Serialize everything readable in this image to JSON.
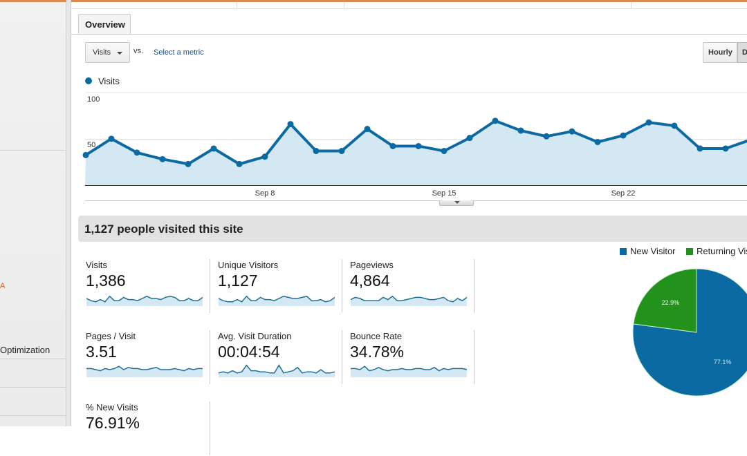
{
  "tabs": [
    {
      "label": "Overview",
      "active": true
    }
  ],
  "controls": {
    "metric_select": "Visits",
    "vs_label": "vs.",
    "select_metric_link": "Select a metric",
    "granularity": [
      "Hourly",
      "D"
    ]
  },
  "colors": {
    "line": "#0b6aa2",
    "area": "#d4e8f4",
    "new_visitor": "#0b6aa2",
    "returning_visitor": "#23921d"
  },
  "sidebar": {
    "partial_red_item": "A",
    "partial_item": "Optimization"
  },
  "chart_data": [
    {
      "type": "area",
      "title": "",
      "legend": [
        "Visits"
      ],
      "xlabel": "",
      "ylabel": "",
      "ylim": [
        0,
        100
      ],
      "yticks": [
        "100",
        "50"
      ],
      "xticks": [
        {
          "label": "Sep 8",
          "index": 7
        },
        {
          "label": "Sep 15",
          "index": 14
        },
        {
          "label": "Sep 22",
          "index": 21
        }
      ],
      "x": [
        "Sep 1",
        "Sep 2",
        "Sep 3",
        "Sep 4",
        "Sep 5",
        "Sep 6",
        "Sep 7",
        "Sep 8",
        "Sep 9",
        "Sep 10",
        "Sep 11",
        "Sep 12",
        "Sep 13",
        "Sep 14",
        "Sep 15",
        "Sep 16",
        "Sep 17",
        "Sep 18",
        "Sep 19",
        "Sep 20",
        "Sep 21",
        "Sep 22",
        "Sep 23",
        "Sep 24",
        "Sep 25",
        "Sep 26",
        "Sep 27"
      ],
      "series": [
        {
          "name": "Visits",
          "values": [
            31,
            51,
            34,
            26,
            20,
            39,
            20,
            29,
            69,
            36,
            36,
            63,
            42,
            42,
            36,
            52,
            73,
            61,
            54,
            60,
            47,
            55,
            71,
            67,
            39,
            39,
            50
          ]
        }
      ]
    },
    {
      "type": "pie",
      "legend": [
        "New Visitor",
        "Returning Visitor"
      ],
      "slices": [
        {
          "name": "New Visitor",
          "value": 77.1,
          "label": "77.1%"
        },
        {
          "name": "Returning Visitor",
          "value": 22.9,
          "label": "22.9%"
        }
      ]
    }
  ],
  "summary": {
    "headline": "1,127 people visited this site"
  },
  "stats": [
    {
      "label": "Visits",
      "value": "1,386",
      "spark": [
        5,
        3,
        2,
        4,
        2,
        7,
        3,
        3,
        6,
        4,
        4,
        3,
        5,
        7,
        5,
        5,
        4,
        6,
        7,
        6,
        3,
        3,
        5,
        3,
        3,
        6
      ]
    },
    {
      "label": "Unique Visitors",
      "value": "1,127",
      "spark": [
        5,
        3,
        2,
        2,
        4,
        2,
        7,
        3,
        3,
        6,
        4,
        4,
        3,
        5,
        7,
        6,
        5,
        5,
        6,
        7,
        3,
        3,
        4,
        2,
        3,
        6
      ]
    },
    {
      "label": "Pageviews",
      "value": "4,864",
      "spark": [
        4,
        6,
        5,
        3,
        3,
        3,
        3,
        6,
        4,
        7,
        3,
        3,
        4,
        5,
        6,
        6,
        5,
        4,
        4,
        5,
        6,
        3,
        2,
        5,
        3,
        6
      ]
    },
    {
      "label": "Pages / Visit",
      "value": "3.51",
      "spark": [
        6,
        6,
        5,
        4,
        6,
        5,
        6,
        8,
        5,
        7,
        6,
        6,
        5,
        5,
        6,
        7,
        5,
        5,
        5,
        6,
        5,
        4,
        6,
        5,
        6,
        6
      ]
    },
    {
      "label": "Avg. Visit Duration",
      "value": "00:04:54",
      "spark": [
        2,
        3,
        2,
        4,
        2,
        3,
        9,
        4,
        4,
        3,
        3,
        2,
        2,
        9,
        2,
        3,
        4,
        7,
        2,
        3,
        3,
        2,
        5,
        2,
        2,
        3
      ]
    },
    {
      "label": "Bounce Rate",
      "value": "34.78%",
      "spark": [
        6,
        6,
        5,
        8,
        4,
        5,
        7,
        5,
        4,
        5,
        5,
        6,
        5,
        5,
        6,
        6,
        5,
        5,
        7,
        4,
        6,
        5,
        6,
        6,
        6,
        5
      ]
    },
    {
      "label": "% New Visits",
      "value": "76.91%",
      "spark": []
    }
  ]
}
